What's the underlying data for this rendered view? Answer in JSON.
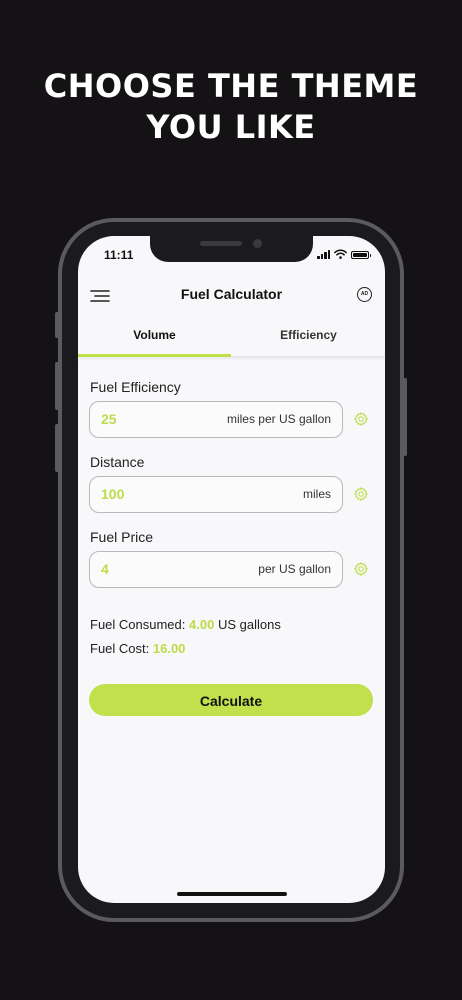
{
  "promo": {
    "line1": "CHOOSE THE THEME",
    "line2": "YOU LIKE"
  },
  "status_bar": {
    "time": "11:11"
  },
  "app": {
    "title": "Fuel Calculator",
    "ad_badge": "AD",
    "menu_icon": "hamburger-menu-icon"
  },
  "tabs": [
    {
      "label": "Volume",
      "active": true
    },
    {
      "label": "Efficiency",
      "active": false
    }
  ],
  "fields": [
    {
      "label": "Fuel Efficiency",
      "value": "25",
      "unit": "miles per US gallon",
      "icon": "gear-icon"
    },
    {
      "label": "Distance",
      "value": "100",
      "unit": "miles",
      "icon": "gear-icon"
    },
    {
      "label": "Fuel Price",
      "value": "4",
      "unit": "per US gallon",
      "icon": "gear-icon"
    }
  ],
  "results": {
    "consumed_label": "Fuel Consumed:",
    "consumed_value": "4.00",
    "consumed_unit": "US gallons",
    "cost_label": "Fuel Cost:",
    "cost_value": "16.00"
  },
  "calculate_label": "Calculate",
  "colors": {
    "background": "#141214",
    "accent": "#c1e04b",
    "screen": "#f8f7f9"
  }
}
